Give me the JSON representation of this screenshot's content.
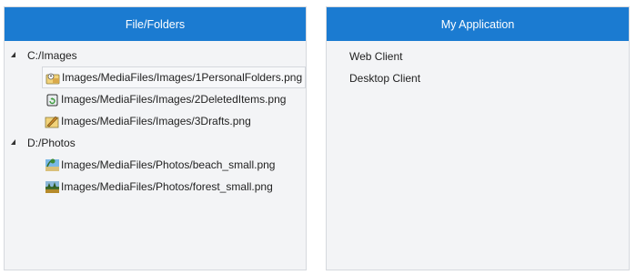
{
  "left": {
    "header": "File/Folders",
    "roots": [
      {
        "label": "C:/Images",
        "children": [
          {
            "label": "Images/MediaFiles/Images/1PersonalFolders.png",
            "icon": "personal-folders-icon"
          },
          {
            "label": "Images/MediaFiles/Images/2DeletedItems.png",
            "icon": "deleted-items-icon"
          },
          {
            "label": "Images/MediaFiles/Images/3Drafts.png",
            "icon": "drafts-icon"
          }
        ]
      },
      {
        "label": "D:/Photos",
        "children": [
          {
            "label": "Images/MediaFiles/Photos/beach_small.png",
            "icon": "beach-photo-icon"
          },
          {
            "label": "Images/MediaFiles/Photos/forest_small.png",
            "icon": "forest-photo-icon"
          }
        ]
      }
    ]
  },
  "right": {
    "header": "My Application",
    "items": [
      "Web Client",
      "Desktop Client"
    ]
  },
  "colors": {
    "header_bg": "#1b7bd1",
    "panel_bg": "#f3f4f6"
  }
}
